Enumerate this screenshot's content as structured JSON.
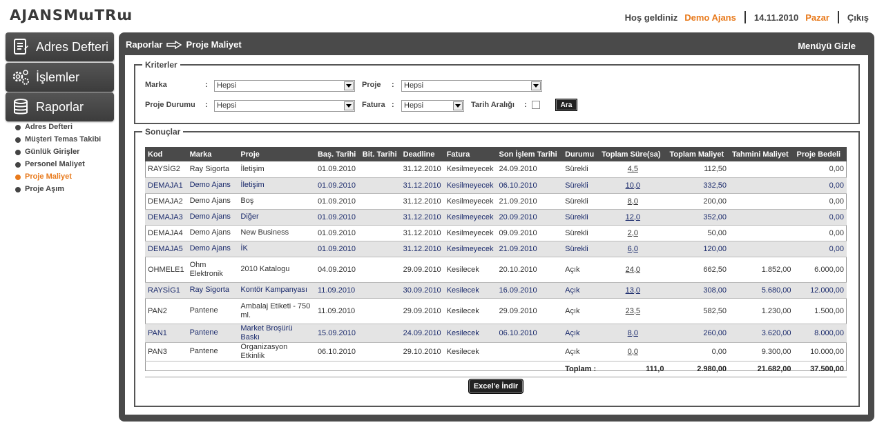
{
  "header": {
    "logo": "AJANSMɯTRɯ",
    "greeting": "Hoş geldiniz",
    "user": "Demo Ajans",
    "date": "14.11.2010",
    "day": "Pazar",
    "logout": "Çıkış"
  },
  "nav": {
    "buttons": [
      {
        "label": "Adres Defteri",
        "icon": "address-book-icon"
      },
      {
        "label": "İşlemler",
        "icon": "gears-icon"
      },
      {
        "label": "Raporlar",
        "icon": "database-icon"
      }
    ],
    "sub_items": [
      {
        "label": "Adres Defteri",
        "active": false
      },
      {
        "label": "Müşteri Temas Takibi",
        "active": false
      },
      {
        "label": "Günlük Girişler",
        "active": false
      },
      {
        "label": "Personel Maliyet",
        "active": false
      },
      {
        "label": "Proje Maliyet",
        "active": true
      },
      {
        "label": "Proje Aşım",
        "active": false
      }
    ]
  },
  "breadcrumb": {
    "parent": "Raporlar",
    "current": "Proje Maliyet"
  },
  "menu_hide": "Menüyü Gizle",
  "criteria": {
    "legend": "Kriterler",
    "marka_label": "Marka",
    "marka_value": "Hepsi",
    "proje_label": "Proje",
    "proje_value": "Hepsi",
    "durum_label": "Proje Durumu",
    "durum_value": "Hepsi",
    "fatura_label": "Fatura",
    "fatura_value": "Hepsi",
    "tarih_label": "Tarih Aralığı",
    "colon": ":",
    "search_button": "Ara"
  },
  "results": {
    "legend": "Sonuçlar",
    "columns": [
      "Kod",
      "Marka",
      "Proje",
      "Baş. Tarihi",
      "Bit. Tarihi",
      "Deadline",
      "Fatura",
      "Son İşlem Tarihi",
      "Durumu",
      "Toplam Süre(sa)",
      "Toplam Maliyet",
      "Tahmini Maliyet",
      "Proje Bedeli"
    ],
    "rows": [
      [
        "RAYSİG2",
        "Ray Sigorta",
        "İletişim",
        "01.09.2010",
        "",
        "31.12.2010",
        "Kesilmeyecek",
        "24.09.2010",
        "Sürekli",
        "4,5",
        "112,50",
        "",
        "0,00"
      ],
      [
        "DEMAJA1",
        "Demo Ajans",
        "İletişim",
        "01.09.2010",
        "",
        "31.12.2010",
        "Kesilmeyecek",
        "06.10.2010",
        "Sürekli",
        "10,0",
        "332,50",
        "",
        "0,00"
      ],
      [
        "DEMAJA2",
        "Demo Ajans",
        "Boş",
        "01.09.2010",
        "",
        "31.12.2010",
        "Kesilmeyecek",
        "21.09.2010",
        "Sürekli",
        "8,0",
        "200,00",
        "",
        "0,00"
      ],
      [
        "DEMAJA3",
        "Demo Ajans",
        "Diğer",
        "01.09.2010",
        "",
        "31.12.2010",
        "Kesilmeyecek",
        "20.09.2010",
        "Sürekli",
        "12,0",
        "352,00",
        "",
        "0,00"
      ],
      [
        "DEMAJA4",
        "Demo Ajans",
        "New Business",
        "01.09.2010",
        "",
        "31.12.2010",
        "Kesilmeyecek",
        "09.09.2010",
        "Sürekli",
        "2,0",
        "50,00",
        "",
        "0,00"
      ],
      [
        "DEMAJA5",
        "Demo Ajans",
        "İK",
        "01.09.2010",
        "",
        "31.12.2010",
        "Kesilmeyecek",
        "21.09.2010",
        "Sürekli",
        "6,0",
        "120,00",
        "",
        "0,00"
      ],
      [
        "OHMELE1",
        "Ohm Elektronik",
        "2010 Katalogu",
        "04.09.2010",
        "",
        "29.09.2010",
        "Kesilecek",
        "20.10.2010",
        "Açık",
        "24,0",
        "662,50",
        "1.852,00",
        "6.000,00"
      ],
      [
        "RAYSİG1",
        "Ray Sigorta",
        "Kontör Kampanyası",
        "11.09.2010",
        "",
        "30.09.2010",
        "Kesilecek",
        "16.09.2010",
        "Açık",
        "13,0",
        "308,00",
        "5.680,00",
        "12.000,00"
      ],
      [
        "PAN2",
        "Pantene",
        "Ambalaj Etiketi - 750 ml.",
        "11.09.2010",
        "",
        "29.09.2010",
        "Kesilecek",
        "29.09.2010",
        "Açık",
        "23,5",
        "582,50",
        "1.230,00",
        "1.500,00"
      ],
      [
        "PAN1",
        "Pantene",
        "Market Broşürü Baskı",
        "15.09.2010",
        "",
        "24.09.2010",
        "Kesilecek",
        "06.10.2010",
        "Açık",
        "8,0",
        "260,00",
        "3.620,00",
        "8.000,00"
      ],
      [
        "PAN3",
        "Pantene",
        "Organizasyon Etkinlik",
        "06.10.2010",
        "",
        "29.10.2010",
        "Kesilecek",
        "",
        "Açık",
        "0,0",
        "0,00",
        "9.300,00",
        "10.000,00"
      ]
    ],
    "total": {
      "label": "Toplam :",
      "sure": "111,0",
      "maliyet": "2.980,00",
      "tahmini": "21.682,00",
      "bedel": "37.500,00"
    }
  },
  "excel_button": "Excel'e İndir"
}
